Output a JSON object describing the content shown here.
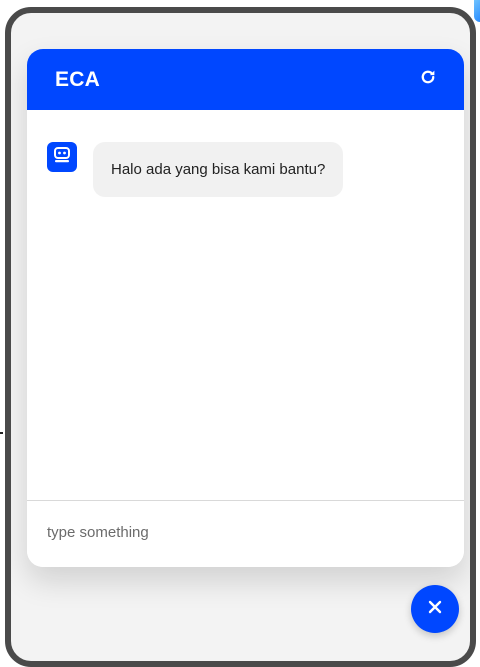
{
  "header": {
    "title": "ECA",
    "refresh_icon": "refresh-icon",
    "background_color": "#0047ff"
  },
  "messages": [
    {
      "sender": "bot",
      "avatar_icon": "robot-icon",
      "text": "Halo ada yang bisa kami bantu?"
    }
  ],
  "input": {
    "placeholder": "type something",
    "value": ""
  },
  "fab": {
    "icon": "close-icon",
    "color": "#0047ff"
  },
  "colors": {
    "accent": "#0047ff",
    "bubble": "#f1f1f1",
    "frame": "#4a4a4a"
  }
}
